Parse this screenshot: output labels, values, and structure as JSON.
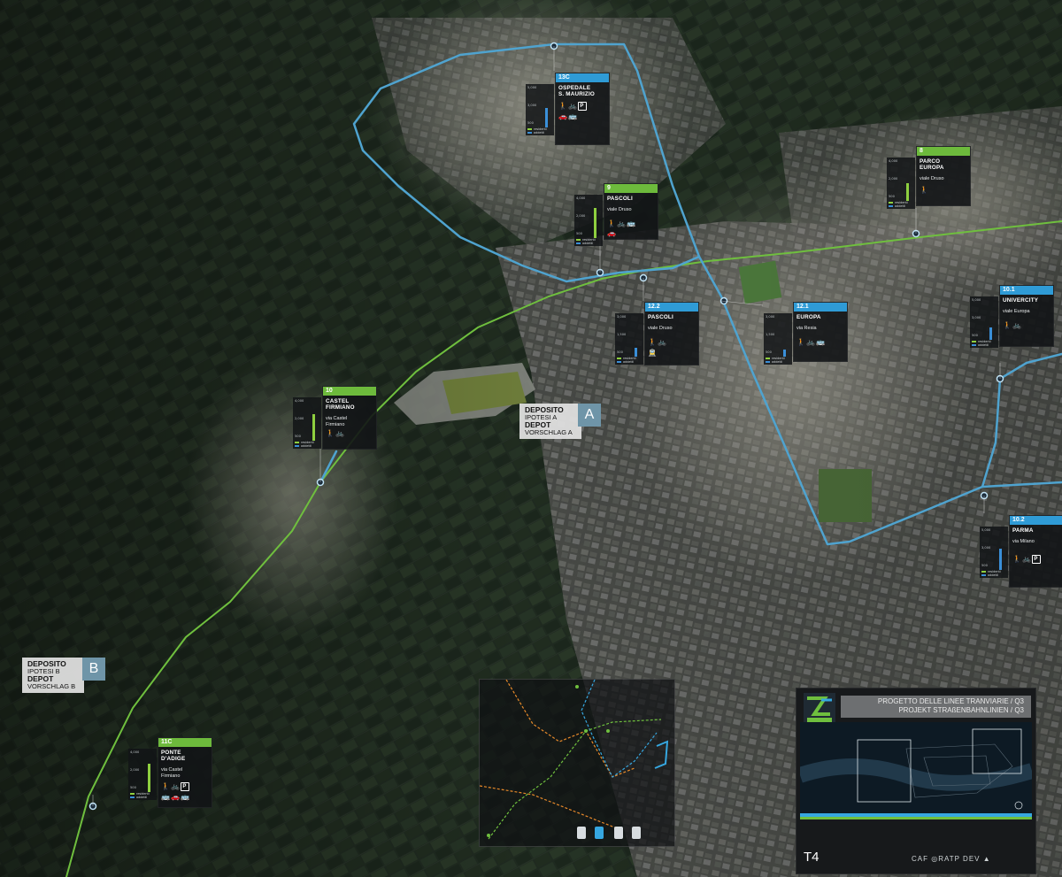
{
  "colors": {
    "blue_line": "#4fa3cf",
    "green_line": "#6fbf3e",
    "card_bg": "#121416",
    "num_green": "#6dba3c",
    "num_blue": "#2f9bd6",
    "bar_green": "#8ecf3f",
    "bar_blue": "#3a8fd8",
    "depot_badge": "#6f95a8"
  },
  "stops": [
    {
      "id": "13c",
      "number": "13C",
      "name": "OSPEDALE\nS. MAURIZIO",
      "street": "",
      "color": "blue",
      "icons": [
        "walk-icon",
        "bike-icon",
        "parking-icon",
        "car-icon",
        "bus-icon"
      ],
      "axis": [
        "5,000",
        "4,500",
        "4,000",
        "3,500",
        "3,000",
        "2,500",
        "2,000",
        "1,500",
        "1,000",
        "500"
      ],
      "legend": [
        "residenti",
        "addetti"
      ]
    },
    {
      "id": "9",
      "number": "9",
      "name": "PASCOLI",
      "street": "viale Druso",
      "color": "green",
      "icons": [
        "walk-icon",
        "bike-icon",
        "bus-icon",
        "car-icon",
        "tram-icon"
      ],
      "axis": [
        "4,000",
        "3,500",
        "3,000",
        "2,500",
        "2,000",
        "1,500",
        "1,000",
        "500"
      ],
      "legend": [
        "residenti",
        "addetti"
      ]
    },
    {
      "id": "8",
      "number": "8",
      "name": "PARCO\nEUROPA",
      "street": "viale Druso",
      "color": "green",
      "icons": [
        "walk-icon"
      ],
      "axis": [
        "4,000",
        "3,500",
        "3,000",
        "2,500",
        "2,000",
        "1,500",
        "1,000",
        "500"
      ],
      "legend": [
        "residenti",
        "addetti"
      ]
    },
    {
      "id": "12-2",
      "number": "12.2",
      "name": "PASCOLI",
      "street": "viale Druso",
      "color": "blue",
      "icons": [
        "walk-icon",
        "bike-icon",
        "tram-icon"
      ],
      "axis": [
        "3,000",
        "2,500",
        "2,000",
        "1,500",
        "1,000",
        "500"
      ],
      "legend": [
        "residenti",
        "addetti"
      ]
    },
    {
      "id": "12-1",
      "number": "12.1",
      "name": "EUROPA",
      "street": "via Resia",
      "color": "blue",
      "icons": [
        "walk-icon",
        "bike-icon",
        "bus-icon"
      ],
      "axis": [
        "3,000",
        "2,500",
        "2,000",
        "1,500",
        "1,000",
        "500"
      ],
      "legend": [
        "residenti",
        "addetti"
      ]
    },
    {
      "id": "10-1",
      "number": "10.1",
      "name": "UNIVERCITY",
      "street": "viale Europa",
      "color": "blue",
      "icons": [
        "walk-icon",
        "bike-icon"
      ],
      "axis": [
        "5,000",
        "4,500",
        "4,000",
        "3,500",
        "3,000",
        "2,500",
        "2,000",
        "1,500",
        "1,000",
        "500"
      ],
      "legend": [
        "residenti",
        "addetti"
      ]
    },
    {
      "id": "10",
      "number": "10",
      "name": "CASTEL\nFIRMIANO",
      "street": "via Castel\nFirmiano",
      "color": "green",
      "icons": [
        "walk-icon",
        "bike-icon"
      ],
      "axis": [
        "4,000",
        "3,500",
        "3,000",
        "2,500",
        "2,000",
        "1,500",
        "1,000",
        "500"
      ],
      "legend": [
        "residenti",
        "addetti"
      ]
    },
    {
      "id": "10-2",
      "number": "10.2",
      "name": "PARMA",
      "street": "via Milano",
      "color": "blue",
      "icons": [
        "walk-icon",
        "bike-icon",
        "parking-icon"
      ],
      "axis": [
        "5,000",
        "4,500",
        "4,000",
        "3,500",
        "3,000",
        "2,500",
        "2,000",
        "1,500",
        "1,000",
        "500"
      ],
      "legend": [
        "residenti",
        "addetti"
      ]
    },
    {
      "id": "11c",
      "number": "11C",
      "name": "PONTE\nD'ADIGE",
      "street": "via Castel\nFirmiano",
      "color": "green",
      "icons": [
        "walk-icon",
        "bike-icon",
        "parking-icon",
        "bus-icon",
        "car-icon",
        "bus-icon"
      ],
      "axis": [
        "4,000",
        "3,500",
        "3,000",
        "2,500",
        "2,000",
        "1,500",
        "1,000",
        "500"
      ],
      "legend": [
        "residenti",
        "addetti"
      ]
    }
  ],
  "depots": [
    {
      "id": "a",
      "letter": "A",
      "label_it": "DEPOSITO",
      "sub_it": "IPOTESI A",
      "label_de": "DEPOT",
      "sub_de": "VORSCHLAG A"
    },
    {
      "id": "b",
      "letter": "B",
      "label_it": "DEPOSITO",
      "sub_it": "IPOTESI B",
      "label_de": "DEPOT",
      "sub_de": "VORSCHLAG B"
    }
  ],
  "title_block": {
    "title_it": "PROGETTO DELLE LINEE TRANVIARIE / Q3",
    "title_de": "PROJEKT STRAßENBAHNLINIEN / Q3",
    "sheet": "T4",
    "logo": "tram-logo",
    "sponsors": [
      "caf-logo",
      "ratp-dev-logo",
      "sellos-group-logo"
    ]
  }
}
